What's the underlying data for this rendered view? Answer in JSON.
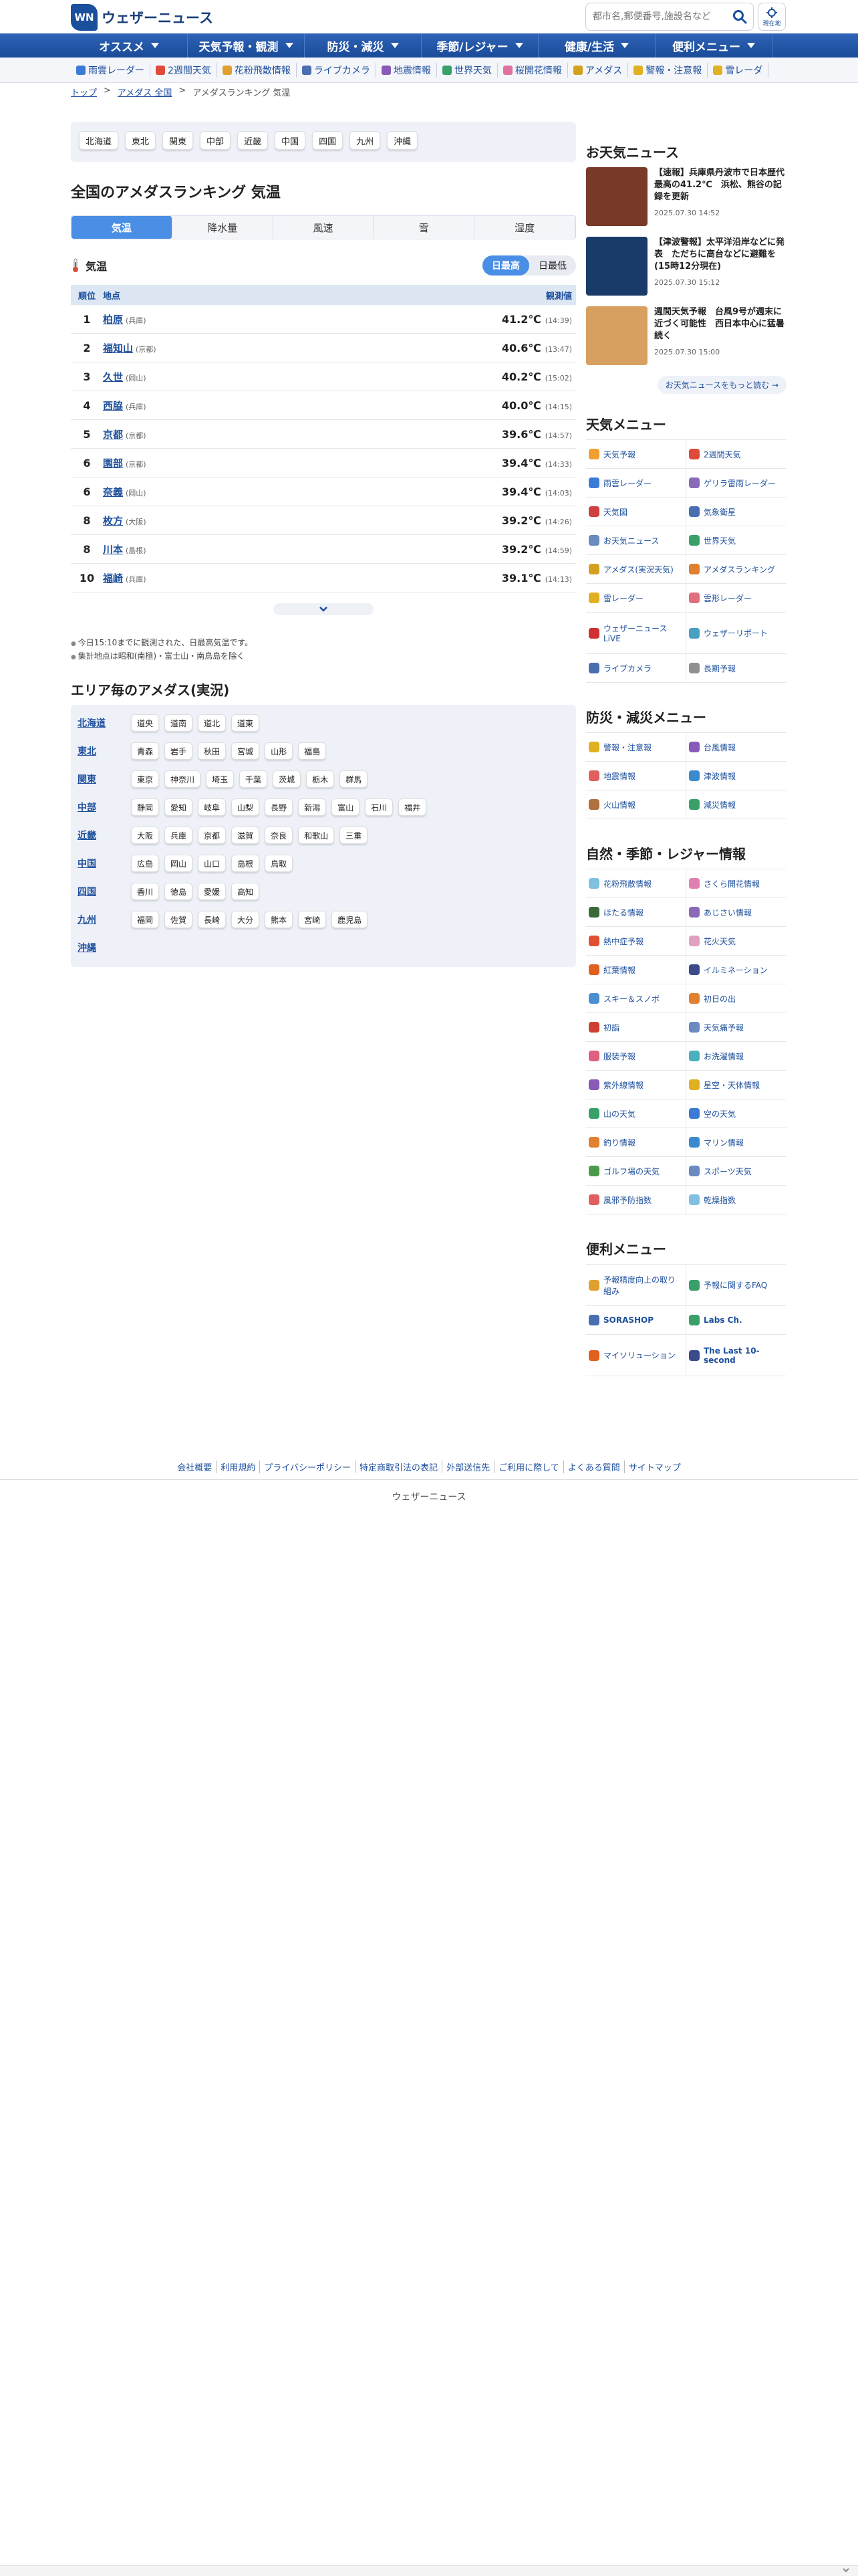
{
  "header": {
    "logo_mark": "WN",
    "logo_text": "ウェザーニュース",
    "search_placeholder": "都市名,郵便番号,施設名など",
    "location_label": "現在地"
  },
  "main_nav": [
    "オススメ",
    "天気予報・観測",
    "防災・減災",
    "季節/レジャー",
    "健康/生活",
    "便利メニュー"
  ],
  "sub_nav": [
    {
      "label": "雨雲レーダー",
      "color": "#3a7bd5"
    },
    {
      "label": "2週間天気",
      "color": "#e04a3a"
    },
    {
      "label": "花粉飛散情報",
      "color": "#e0a030"
    },
    {
      "label": "ライブカメラ",
      "color": "#4a6fb0"
    },
    {
      "label": "地震情報",
      "color": "#8a5ab8"
    },
    {
      "label": "世界天気",
      "color": "#3aa06a"
    },
    {
      "label": "桜開花情報",
      "color": "#e070a0"
    },
    {
      "label": "アメダス",
      "color": "#d4a020"
    },
    {
      "label": "警報・注意報",
      "color": "#e0b020"
    },
    {
      "label": "雪レーダ",
      "color": "#e0b020"
    }
  ],
  "breadcrumb": {
    "top": "トップ",
    "amedas": "アメダス 全国",
    "current": "アメダスランキング 気温"
  },
  "regions": [
    "北海道",
    "東北",
    "関東",
    "中部",
    "近畿",
    "中国",
    "四国",
    "九州",
    "沖縄"
  ],
  "page_title": "全国のアメダスランキング 気温",
  "tabs": [
    "気温",
    "降水量",
    "風速",
    "雪",
    "湿度"
  ],
  "metric": {
    "label": "気温",
    "toggle_high": "日最高",
    "toggle_low": "日最低"
  },
  "table": {
    "headers": {
      "rank": "順位",
      "place": "地点",
      "value": "観測値"
    },
    "rows": [
      {
        "rank": "1",
        "place": "柏原",
        "pref": "(兵庫)",
        "value": "41.2℃",
        "time": "(14:39)"
      },
      {
        "rank": "2",
        "place": "福知山",
        "pref": "(京都)",
        "value": "40.6℃",
        "time": "(13:47)"
      },
      {
        "rank": "3",
        "place": "久世",
        "pref": "(岡山)",
        "value": "40.2℃",
        "time": "(15:02)"
      },
      {
        "rank": "4",
        "place": "西脇",
        "pref": "(兵庫)",
        "value": "40.0℃",
        "time": "(14:15)"
      },
      {
        "rank": "5",
        "place": "京都",
        "pref": "(京都)",
        "value": "39.6℃",
        "time": "(14:57)"
      },
      {
        "rank": "6",
        "place": "園部",
        "pref": "(京都)",
        "value": "39.4℃",
        "time": "(14:33)"
      },
      {
        "rank": "6",
        "place": "奈義",
        "pref": "(岡山)",
        "value": "39.4℃",
        "time": "(14:03)"
      },
      {
        "rank": "8",
        "place": "枚方",
        "pref": "(大阪)",
        "value": "39.2℃",
        "time": "(14:26)"
      },
      {
        "rank": "8",
        "place": "川本",
        "pref": "(島根)",
        "value": "39.2℃",
        "time": "(14:59)"
      },
      {
        "rank": "10",
        "place": "福崎",
        "pref": "(兵庫)",
        "value": "39.1℃",
        "time": "(14:13)"
      }
    ]
  },
  "notes": [
    "今日15:10までに観測された、日最高気温です。",
    "集計地点は昭和(南極)・富士山・南鳥島を除く"
  ],
  "area_title": "エリア毎のアメダス(実況)",
  "areas": [
    {
      "name": "北海道",
      "prefs": [
        "道央",
        "道南",
        "道北",
        "道東"
      ]
    },
    {
      "name": "東北",
      "prefs": [
        "青森",
        "岩手",
        "秋田",
        "宮城",
        "山形",
        "福島"
      ]
    },
    {
      "name": "関東",
      "prefs": [
        "東京",
        "神奈川",
        "埼玉",
        "千葉",
        "茨城",
        "栃木",
        "群馬"
      ]
    },
    {
      "name": "中部",
      "prefs": [
        "静岡",
        "愛知",
        "岐阜",
        "山梨",
        "長野",
        "新潟",
        "富山",
        "石川",
        "福井"
      ]
    },
    {
      "name": "近畿",
      "prefs": [
        "大阪",
        "兵庫",
        "京都",
        "滋賀",
        "奈良",
        "和歌山",
        "三重"
      ]
    },
    {
      "name": "中国",
      "prefs": [
        "広島",
        "岡山",
        "山口",
        "島根",
        "鳥取"
      ]
    },
    {
      "name": "四国",
      "prefs": [
        "香川",
        "徳島",
        "愛媛",
        "高知"
      ]
    },
    {
      "name": "九州",
      "prefs": [
        "福岡",
        "佐賀",
        "長崎",
        "大分",
        "熊本",
        "宮崎",
        "鹿児島"
      ]
    },
    {
      "name": "沖縄",
      "prefs": []
    }
  ],
  "weather_news": {
    "title": "お天気ニュース",
    "items": [
      {
        "text": "【速報】兵庫県丹波市で日本歴代最高の41.2℃　浜松、熊谷の記録を更新",
        "date": "2025.07.30 14:52",
        "thumb_color": "#7a3a2a"
      },
      {
        "text": "【津波警報】太平洋沿岸などに発表　ただちに高台などに避難を (15時12分現在)",
        "date": "2025.07.30 15:12",
        "thumb_color": "#1a3a6a"
      },
      {
        "text": "週間天気予報　台風9号が週末に近づく可能性　西日本中心に猛暑続く",
        "date": "2025.07.30 15:00",
        "thumb_color": "#d8a060"
      }
    ],
    "more": "お天気ニュースをもっと読む"
  },
  "weather_menu": {
    "title": "天気メニュー",
    "items": [
      {
        "label": "天気予報",
        "color": "#f0a030"
      },
      {
        "label": "2週間天気",
        "color": "#e04a3a"
      },
      {
        "label": "雨雲レーダー",
        "color": "#3a7bd5"
      },
      {
        "label": "ゲリラ雷雨レーダー",
        "color": "#8a6ab8"
      },
      {
        "label": "天気図",
        "color": "#d04040"
      },
      {
        "label": "気象衛星",
        "color": "#4a6fb0"
      },
      {
        "label": "お天気ニュース",
        "color": "#6a8ac0"
      },
      {
        "label": "世界天気",
        "color": "#3aa06a"
      },
      {
        "label": "アメダス(実況天気)",
        "color": "#d4a020"
      },
      {
        "label": "アメダスランキング",
        "color": "#e08030"
      },
      {
        "label": "雷レーダー",
        "color": "#e0b020"
      },
      {
        "label": "雲形レーダー",
        "color": "#e07080"
      },
      {
        "label": "ウェザーニュースLiVE",
        "color": "#d03030",
        "tall": true
      },
      {
        "label": "ウェザーリポート",
        "color": "#4aa0c0",
        "tall": true
      },
      {
        "label": "ライブカメラ",
        "color": "#4a6fb0"
      },
      {
        "label": "長期予報",
        "color": "#909090"
      }
    ]
  },
  "bousai_menu": {
    "title": "防災・減災メニュー",
    "items": [
      {
        "label": "警報・注意報",
        "color": "#e0b020"
      },
      {
        "label": "台風情報",
        "color": "#8a5ab8"
      },
      {
        "label": "地震情報",
        "color": "#e06060"
      },
      {
        "label": "津波情報",
        "color": "#3a8ad0"
      },
      {
        "label": "火山情報",
        "color": "#b07040"
      },
      {
        "label": "減災情報",
        "color": "#3aa06a"
      }
    ]
  },
  "leisure_menu": {
    "title": "自然・季節・レジャー情報",
    "items": [
      {
        "label": "花粉飛散情報",
        "color": "#80c0e0"
      },
      {
        "label": "さくら開花情報",
        "color": "#e080b0"
      },
      {
        "label": "ほたる情報",
        "color": "#3a6a3a"
      },
      {
        "label": "あじさい情報",
        "color": "#8a6ab8"
      },
      {
        "label": "熱中症予報",
        "color": "#e05030"
      },
      {
        "label": "花火天気",
        "color": "#e0a0c0"
      },
      {
        "label": "紅葉情報",
        "color": "#e06020"
      },
      {
        "label": "イルミネーション",
        "color": "#3a4a8a"
      },
      {
        "label": "スキー＆スノボ",
        "color": "#4a90d0"
      },
      {
        "label": "初日の出",
        "color": "#e08030"
      },
      {
        "label": "初詣",
        "color": "#d04030"
      },
      {
        "label": "天気痛予報",
        "color": "#6a8ac0"
      },
      {
        "label": "服装予報",
        "color": "#e06080"
      },
      {
        "label": "お洗濯情報",
        "color": "#4ab0c0"
      },
      {
        "label": "紫外線情報",
        "color": "#8a5ab8"
      },
      {
        "label": "星空・天体情報",
        "color": "#e0b020"
      },
      {
        "label": "山の天気",
        "color": "#3aa06a"
      },
      {
        "label": "空の天気",
        "color": "#3a7bd5"
      },
      {
        "label": "釣り情報",
        "color": "#e08030"
      },
      {
        "label": "マリン情報",
        "color": "#3a8ad0"
      },
      {
        "label": "ゴルフ場の天気",
        "color": "#4a9a4a"
      },
      {
        "label": "スポーツ天気",
        "color": "#6a8ac0"
      },
      {
        "label": "風邪予防指数",
        "color": "#e06060"
      },
      {
        "label": "乾燥指数",
        "color": "#80c0e0"
      }
    ]
  },
  "benri_menu": {
    "title": "便利メニュー",
    "items": [
      {
        "label": "予報精度向上の取り組み",
        "color": "#e0a030",
        "tall": true
      },
      {
        "label": "予報に関するFAQ",
        "color": "#3aa06a",
        "tall": true
      },
      {
        "label": "SORASHOP",
        "color": "#4a6fb0",
        "bold": true
      },
      {
        "label": "Labs Ch.",
        "color": "#3aa06a",
        "bold": true
      },
      {
        "label": "マイソリューション",
        "color": "#e06020",
        "tall": true
      },
      {
        "label": "The Last 10-second",
        "color": "#3a4a8a",
        "tall": true,
        "bold": true
      }
    ]
  },
  "footer": {
    "links": [
      "会社概要",
      "利用規約",
      "プライバシーポリシー",
      "特定商取引法の表記",
      "外部送信先",
      "ご利用に際して",
      "よくある質問",
      "サイトマップ"
    ],
    "copyright": "ウェザーニュース"
  }
}
